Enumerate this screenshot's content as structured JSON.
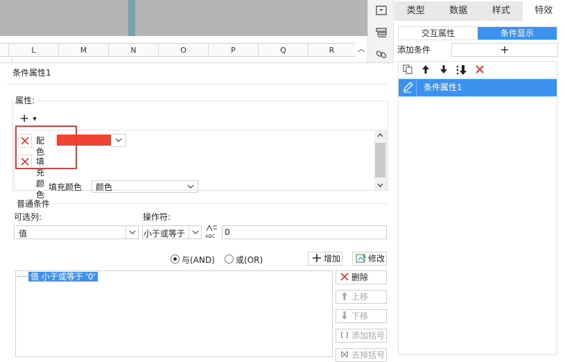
{
  "sheet": {
    "columns": [
      "L",
      "M",
      "N",
      "O",
      "P",
      "Q",
      "R"
    ],
    "scroll_up": "︿"
  },
  "icon_strip": [
    "widget-icon",
    "layers-icon",
    "link-icon"
  ],
  "right_panel": {
    "tabs": [
      {
        "label": "类型",
        "active": false
      },
      {
        "label": "数据",
        "active": false
      },
      {
        "label": "样式",
        "active": false
      },
      {
        "label": "特效",
        "active": true
      }
    ],
    "sub_tabs": [
      {
        "label": "交互属性",
        "active": false
      },
      {
        "label": "条件显示",
        "active": true
      }
    ],
    "add_condition_label": "添加条件",
    "add_condition_button": "+",
    "toolbar": [
      "copy-icon",
      "move-up-icon",
      "move-down-icon",
      "sort-down-icon",
      "delete-icon"
    ],
    "conditions": [
      {
        "label": "条件属性1",
        "selected": true
      }
    ]
  },
  "dialog": {
    "title": "条件属性1",
    "properties_label": "属性:",
    "add_property_button": "+",
    "properties": [
      {
        "label": "配色"
      },
      {
        "label": "填充颜色"
      }
    ],
    "color_value": "#ee4335",
    "hidden_row": {
      "label": "填充颜色",
      "value": "颜色"
    },
    "normal_condition_label": "普通条件",
    "column_select_label": "可选列:",
    "column_select_value": "值",
    "operator_label": "操作符:",
    "operator_value": "小于或等于",
    "formula_icon": "ABC",
    "value_input": "0",
    "and_label": "与(AND)",
    "or_label": "或(OR)",
    "and_selected": true,
    "buttons": {
      "add": "增加",
      "modify": "修改",
      "delete": "删除",
      "move_up": "上移",
      "move_down": "下移",
      "add_bracket": "添加括号",
      "remove_bracket": "去掉括号"
    },
    "condition_expression": "值 小于或等于 '0'"
  },
  "colors": {
    "accent": "#3e92ef",
    "highlight": "#e53935",
    "swatch": "#ee4335"
  }
}
